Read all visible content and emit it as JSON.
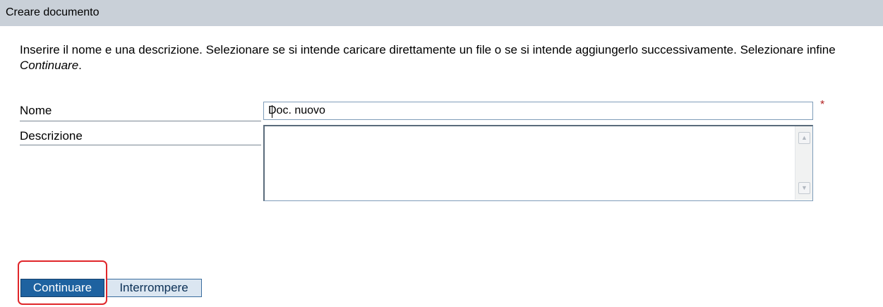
{
  "panel": {
    "title": "Creare documento"
  },
  "instructions": {
    "text_before": "Inserire il nome e una descrizione. Selezionare se si intende caricare direttamente un file o se si intende aggiungerlo successivamente. Selezionare infine ",
    "emphasis": "Continuare",
    "text_after": "."
  },
  "form": {
    "name_label": "Nome",
    "name_value": "Doc. nuovo",
    "required_marker": "*",
    "description_label": "Descrizione",
    "description_value": ""
  },
  "scrollbar": {
    "up_icon": "scroll-up-arrow",
    "down_icon": "scroll-down-arrow"
  },
  "buttons": {
    "continue_label": "Continuare",
    "stop_label": "Interrompere"
  },
  "colors": {
    "title_bar": "#c9d0d8",
    "primary_button": "#1e62a0",
    "secondary_button": "#dbe6f1",
    "required": "#b22222",
    "highlight": "#e0262a"
  }
}
